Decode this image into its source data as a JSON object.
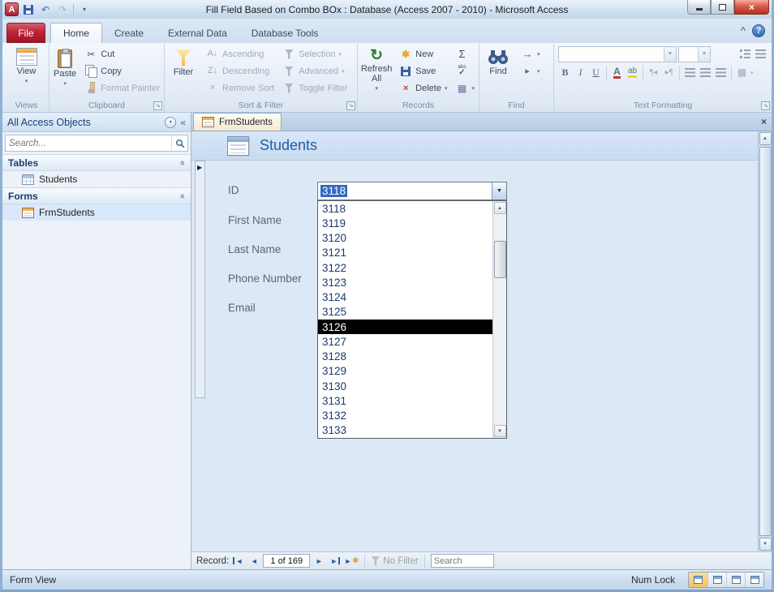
{
  "window": {
    "title": "Fill Field Based on Combo BOx : Database (Access 2007 - 2010)  -  Microsoft Access"
  },
  "tabs": {
    "file": "File",
    "home": "Home",
    "create": "Create",
    "external_data": "External Data",
    "database_tools": "Database Tools"
  },
  "ribbon": {
    "views": {
      "view_label": "View",
      "group_label": "Views"
    },
    "clipboard": {
      "paste": "Paste",
      "cut": "Cut",
      "copy": "Copy",
      "format_painter": "Format Painter",
      "group_label": "Clipboard"
    },
    "sort_filter": {
      "filter": "Filter",
      "ascending": "Ascending",
      "descending": "Descending",
      "remove_sort": "Remove Sort",
      "selection": "Selection",
      "advanced": "Advanced",
      "toggle_filter": "Toggle Filter",
      "group_label": "Sort & Filter"
    },
    "records": {
      "refresh_all": "Refresh All",
      "new": "New",
      "save": "Save",
      "delete": "Delete",
      "group_label": "Records"
    },
    "find": {
      "find": "Find",
      "group_label": "Find"
    },
    "text_formatting": {
      "group_label": "Text Formatting"
    }
  },
  "nav_pane": {
    "title": "All Access Objects",
    "search_placeholder": "Search...",
    "sections": [
      {
        "label": "Tables",
        "items": [
          "Students"
        ]
      },
      {
        "label": "Forms",
        "items": [
          "FrmStudents"
        ]
      }
    ]
  },
  "document": {
    "tab_label": "FrmStudents",
    "form_title": "Students",
    "field_labels": [
      "ID",
      "First Name",
      "Last Name",
      "Phone Number",
      "Email"
    ],
    "combo": {
      "value": "3118",
      "selected_option": "3126",
      "options": [
        "3118",
        "3119",
        "3120",
        "3121",
        "3122",
        "3123",
        "3124",
        "3125",
        "3126",
        "3127",
        "3128",
        "3129",
        "3130",
        "3131",
        "3132",
        "3133"
      ]
    }
  },
  "record_nav": {
    "label": "Record:",
    "position": "1 of 169",
    "no_filter": "No Filter",
    "search_placeholder": "Search"
  },
  "status_bar": {
    "view_name": "Form View",
    "num_lock": "Num Lock"
  },
  "icons": {
    "access_logo": "A",
    "undo": "↶",
    "redo": "↷",
    "qat_menu": "▾",
    "close": "×",
    "help": "?",
    "ribbon_collapse": "^",
    "dropdown": "▾",
    "dropdown_solid": "▼",
    "cut": "✂",
    "ascending": "A↓",
    "descending": "Z↓",
    "remove_sort": "×",
    "refresh": "↻",
    "new_record": "✱",
    "delete": "×",
    "totals": "Σ",
    "spelling_check": "✓",
    "spelling_abc": "abc",
    "more": "▦",
    "go_to": "→",
    "select": "▸",
    "bold": "B",
    "italic": "I",
    "underline": "U",
    "font_color": "A",
    "highlight": "ab",
    "ltr": "¶◂",
    "rtl": "▸¶",
    "gridlines": "▦",
    "pane_menu": "▾",
    "pane_collapse": "«",
    "section_chevron": "»",
    "tab_close": "×",
    "scroll_up": "▲",
    "scroll_down": "▼",
    "record_marker": "▶",
    "nav_first": "◄",
    "nav_prev": "◄",
    "nav_next": "►",
    "nav_last": "►",
    "nav_new": "►"
  }
}
